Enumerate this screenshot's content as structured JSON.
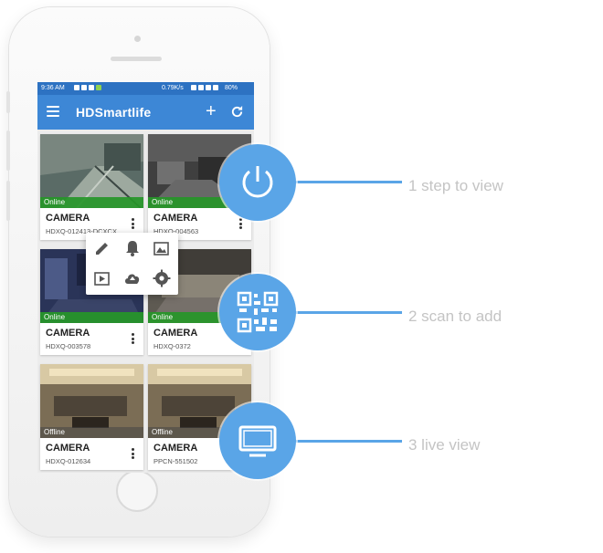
{
  "statusbar": {
    "time": "9:36 AM",
    "network_speed": "0.79K/s",
    "battery": "80%"
  },
  "app": {
    "title": "HDSmartlife",
    "add_icon": "+",
    "menu_icon": "menu-icon",
    "refresh_icon": "refresh-icon"
  },
  "cameras": [
    {
      "name": "CAMERA",
      "id": "HDXQ-012413-DCXCX",
      "status": "Online"
    },
    {
      "name": "CAMERA",
      "id": "HDXQ-004563",
      "status": "Online"
    },
    {
      "name": "CAMERA",
      "id": "HDXQ-003578",
      "status": "Online"
    },
    {
      "name": "CAMERA",
      "id": "HDXQ-0372",
      "status": "Online"
    },
    {
      "name": "CAMERA",
      "id": "HDXQ-012634",
      "status": "Offline"
    },
    {
      "name": "CAMERA",
      "id": "PPCN-551502",
      "status": "Offline"
    }
  ],
  "popup_menu": {
    "icons": [
      "edit-icon",
      "bell-icon",
      "gallery-icon",
      "video-playback-icon",
      "cloud-upload-icon",
      "settings-icon"
    ]
  },
  "features": [
    {
      "icon": "power-icon",
      "label": "1 step to view"
    },
    {
      "icon": "qr-code-icon",
      "label": "2 scan to add"
    },
    {
      "icon": "monitor-icon",
      "label": "3 live view"
    }
  ],
  "colors": {
    "accent": "#3d87d6",
    "statusbar": "#2d72c2",
    "feature": "#5aa5e7",
    "online": "#269628",
    "offline": "#464646"
  }
}
